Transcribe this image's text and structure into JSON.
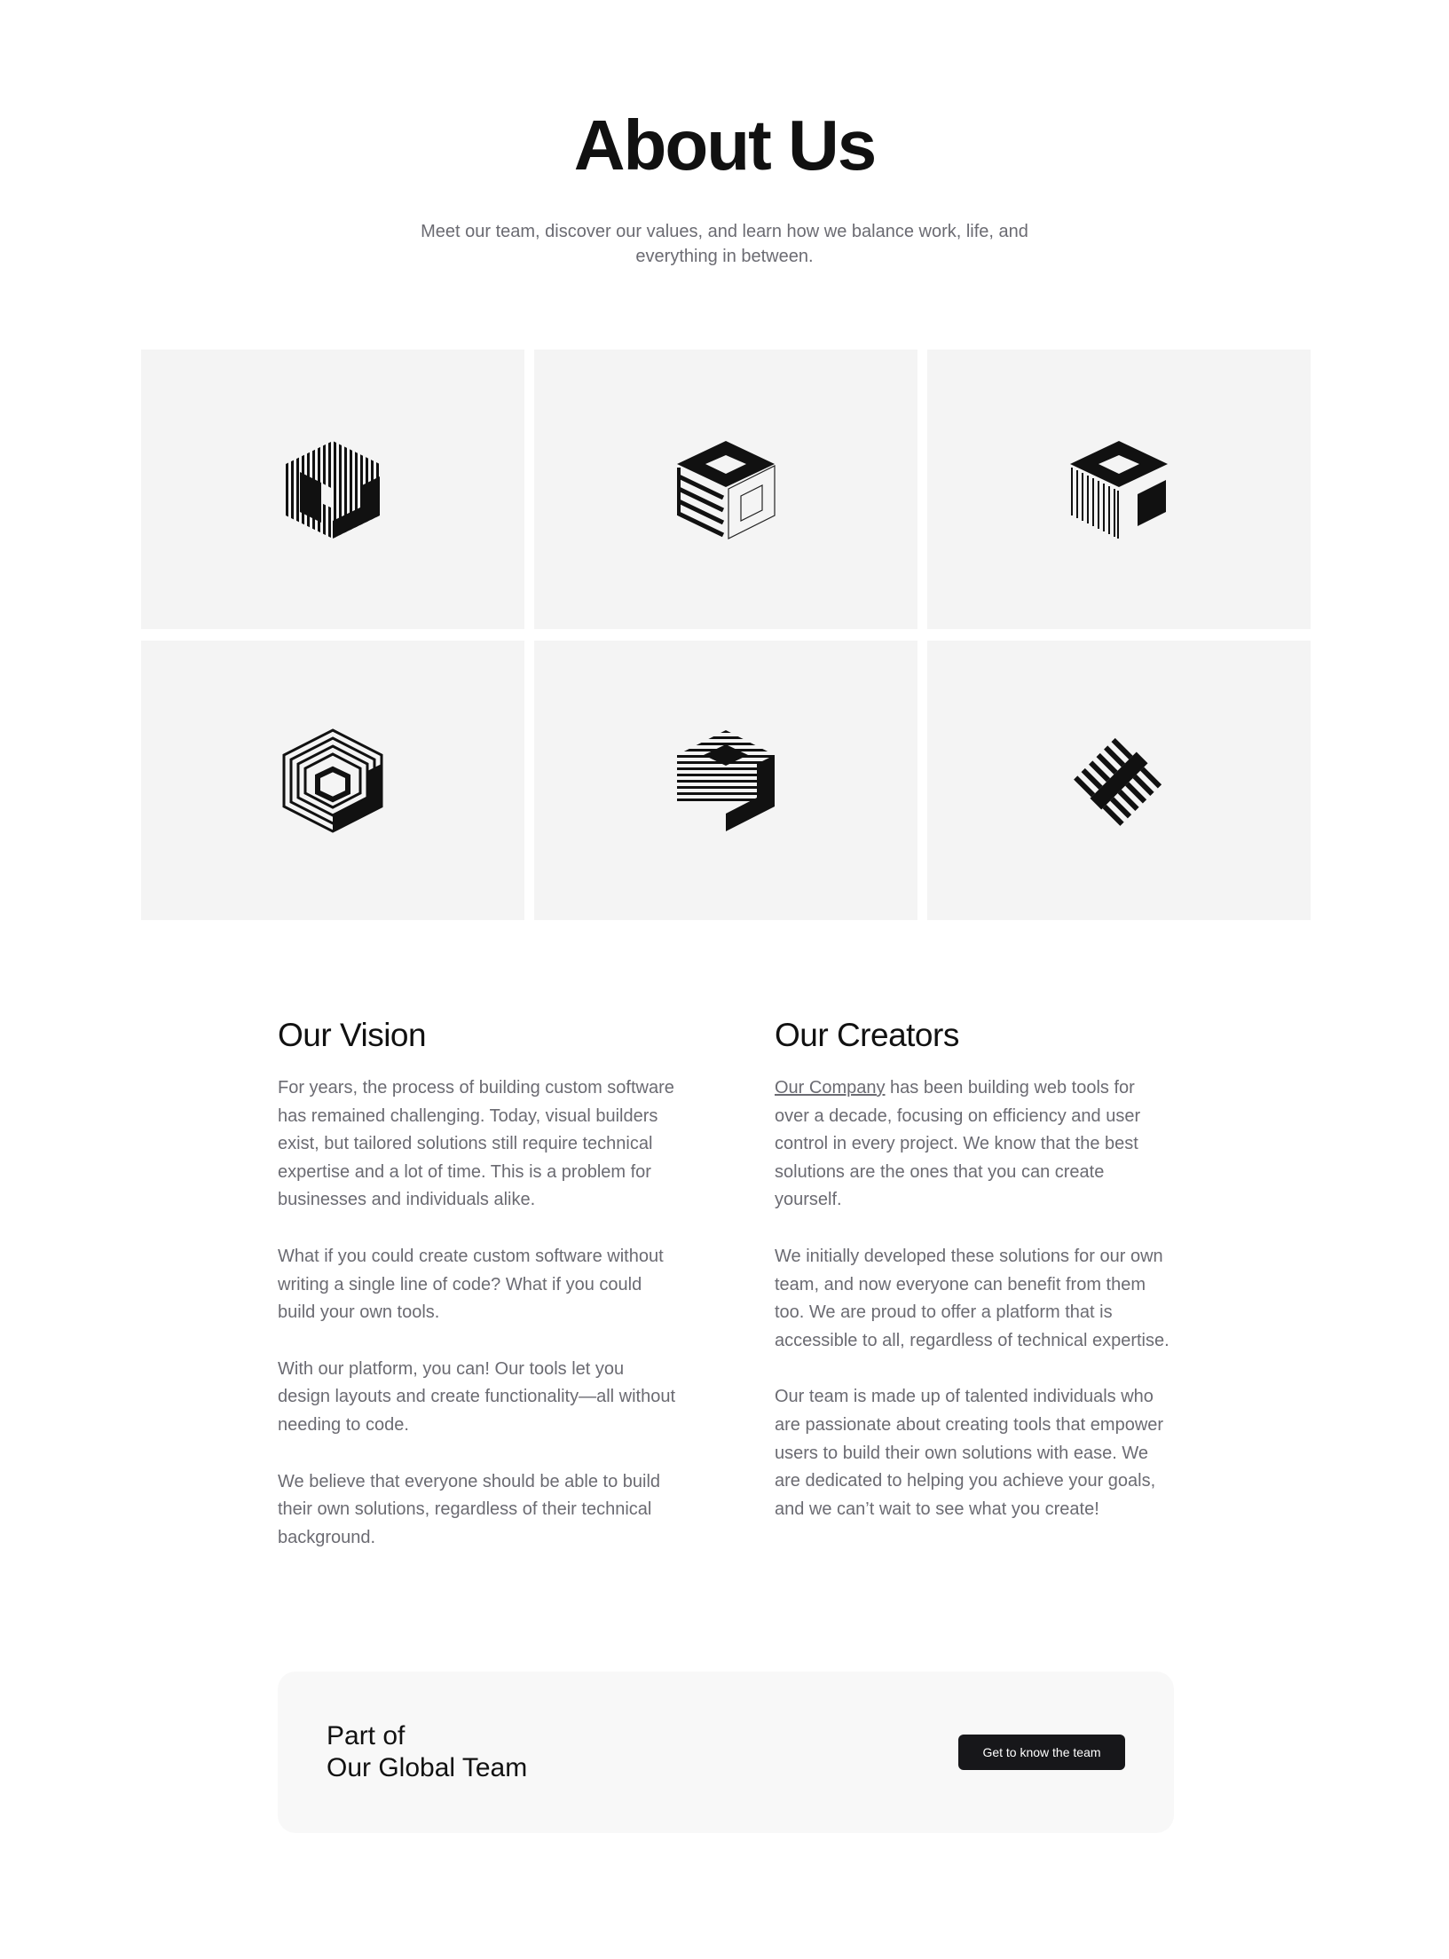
{
  "hero": {
    "title": "About Us",
    "subtitle": "Meet our team, discover our values, and learn how we balance work, life, and everything in between."
  },
  "logo_grid": {
    "tile_color": "#f4f4f4",
    "icons": [
      "striped-cube-logo-icon",
      "wireframe-cube-logo-icon",
      "lined-cube-logo-icon",
      "concentric-hexagon-logo-icon",
      "horizontal-stripe-cube-logo-icon",
      "comb-diamond-logo-icon"
    ]
  },
  "vision": {
    "heading": "Our Vision",
    "paragraphs": [
      "For years, the process of building custom software has remained challenging. Today, visual builders exist, but tailored solutions still require technical expertise and a lot of time. This is a problem for businesses and individuals alike.",
      "What if you could create custom software without writing a single line of code? What if you could build your own tools.",
      "With our platform, you can! Our tools let you design layouts and create functionality—all without needing to code.",
      "We believe that everyone should be able to build their own solutions, regardless of their technical background."
    ]
  },
  "creators": {
    "heading": "Our Creators",
    "link_text": "Our Company",
    "first_paragraph_rest": " has been building web tools for over a decade, focusing on efficiency and user control in every project. We know that the best solutions are the ones that you can create yourself.",
    "paragraphs": [
      "We initially developed these solutions for our own team, and now everyone can benefit from them too. We are proud to offer a platform that is accessible to all, regardless of technical expertise.",
      "Our team is made up of talented individuals who are passionate about creating tools that empower users to build their own solutions with ease. We are dedicated to helping you achieve your goals, and we can’t wait to see what you create!"
    ]
  },
  "cta": {
    "title_line1": "Part of",
    "title_line2": "Our Global Team",
    "button_label": "Get to know the team"
  },
  "colors": {
    "text_primary": "#111111",
    "text_secondary": "#6b6b72",
    "button_bg": "#17171a",
    "card_bg": "#f8f8f8"
  }
}
